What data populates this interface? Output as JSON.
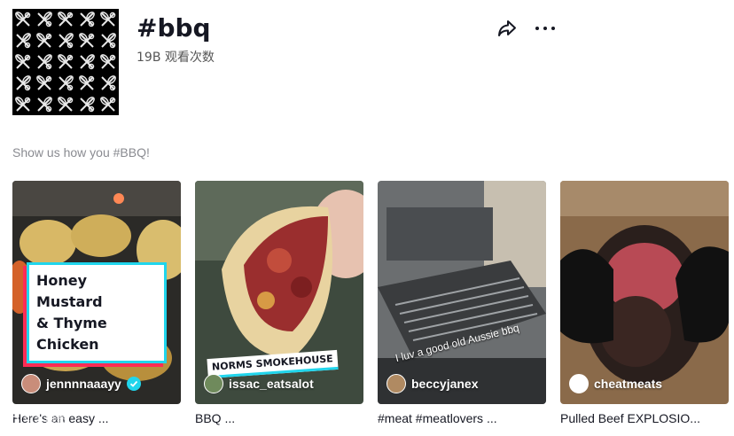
{
  "header": {
    "hashtag": "#bbq",
    "views": "19B 观看次数",
    "cover_icon": "whisk-pattern-icon"
  },
  "actions": {
    "share_icon": "share-icon",
    "more_icon": "more-dots-icon"
  },
  "description": "Show us how you #BBQ!",
  "videos": [
    {
      "author": "jennnnaaayy",
      "verified": true,
      "caption": "Here's an easy ...",
      "overlay_lines": [
        "Honey Mustard",
        "& Thyme Chicken"
      ]
    },
    {
      "author": "issac_eatsalot",
      "verified": false,
      "caption": "BBQ ...",
      "sticker": "NORMS SMOKEHOUSE"
    },
    {
      "author": "beccyjanex",
      "verified": false,
      "caption": "#meat #meatlovers ...",
      "overlay_text": "I luv a good old Aussie bbq"
    },
    {
      "author": "cheatmeats",
      "verified": false,
      "caption": "Pulled Beef EXPLOSIO..."
    }
  ],
  "watermark": "头条搜索",
  "colors": {
    "accent_cyan": "#20d5ec",
    "accent_red": "#fe2c55",
    "muted_text": "#8a8b91"
  }
}
